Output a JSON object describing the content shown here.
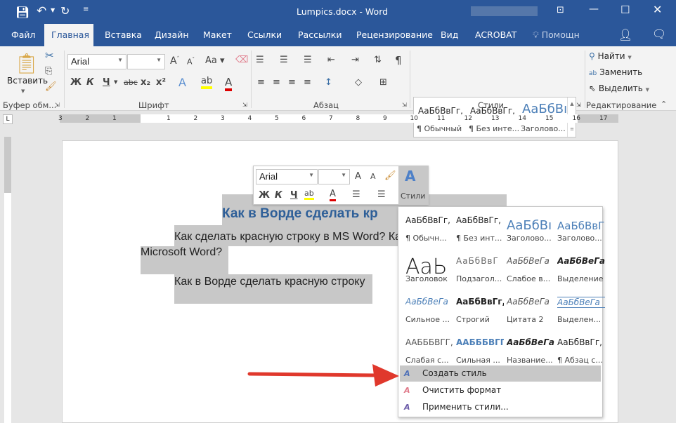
{
  "app": {
    "title": "Lumpics.docx - Word"
  },
  "quick_access": {
    "save": "save-icon",
    "undo": "undo-icon",
    "redo": "redo-icon",
    "customize": "customize-icon"
  },
  "tabs": [
    {
      "label": "Файл"
    },
    {
      "label": "Главная",
      "active": true
    },
    {
      "label": "Вставка"
    },
    {
      "label": "Дизайн"
    },
    {
      "label": "Макет"
    },
    {
      "label": "Ссылки"
    },
    {
      "label": "Рассылки"
    },
    {
      "label": "Рецензирование"
    },
    {
      "label": "Вид"
    },
    {
      "label": "ACROBAT"
    },
    {
      "label": "Помощн"
    }
  ],
  "ribbon": {
    "clipboard": {
      "paste": "Вставить",
      "group": "Буфер обм..."
    },
    "font": {
      "name": "Arial",
      "size": "",
      "bold": "Ж",
      "italic": "К",
      "underline": "Ч",
      "strike": "abc",
      "sub": "x₂",
      "sup": "x²",
      "case": "Aa",
      "group": "Шрифт"
    },
    "paragraph": {
      "group": "Абзац",
      "pilcrow": "¶"
    },
    "styles": {
      "group": "Стили",
      "items": [
        {
          "preview": "АаБбВвГг,",
          "name": "¶ Обычный"
        },
        {
          "preview": "АаБбВвГг,",
          "name": "¶ Без инте..."
        },
        {
          "preview": "АаБбВı",
          "name": "Заголово..."
        }
      ]
    },
    "editing": {
      "find": "Найти",
      "replace": "Заменить",
      "select": "Выделить",
      "group": "Редактирование"
    }
  },
  "ruler": {
    "ticks": [
      "3",
      "2",
      "1",
      "",
      "1",
      "2",
      "3",
      "4",
      "5",
      "6",
      "7",
      "8",
      "9",
      "10",
      "11",
      "12",
      "13",
      "14",
      "15",
      "16",
      "17"
    ]
  },
  "document": {
    "heading": "Как в Ворде сделать кр",
    "para1": "Как сделать красную строку в MS Word? Ка",
    "para1b": "Microsoft Word?",
    "para2": "Как в Ворде сделать красную строку"
  },
  "mini_toolbar": {
    "font": "Arial",
    "size": "",
    "bold": "Ж",
    "italic": "К",
    "underline": "Ч",
    "styles": "Стили"
  },
  "styles_menu": {
    "grid": [
      {
        "preview": "АаБбВвГг,",
        "name": "¶ Обычн..."
      },
      {
        "preview": "АаБбВвГг,",
        "name": "¶ Без инт..."
      },
      {
        "preview": "АаБбВı",
        "name": "Заголово..."
      },
      {
        "preview": "АаБбВвГ",
        "name": "Заголово..."
      },
      {
        "preview": "АаЬ",
        "name": "Заголовок"
      },
      {
        "preview": "АаБбВвГ",
        "name": "Подзагол..."
      },
      {
        "preview": "АаБбВеГа",
        "name": "Слабое в..."
      },
      {
        "preview": "АаБбВеГа",
        "name": "Выделение"
      },
      {
        "preview": "АаБбВеГа",
        "name": "Сильное ..."
      },
      {
        "preview": "АаБбВвГг,",
        "name": "Строгий"
      },
      {
        "preview": "АаБбВеГа",
        "name": "Цитата 2"
      },
      {
        "preview": "АаБбВеГа",
        "name": "Выделен..."
      },
      {
        "preview": "ААБББВГГ,",
        "name": "Слабая с..."
      },
      {
        "preview": "ААБББВГГ,",
        "name": "Сильная ..."
      },
      {
        "preview": "АаБбВеГа",
        "name": "Название..."
      },
      {
        "preview": "АаБбВвГг,",
        "name": "¶ Абзац с..."
      }
    ],
    "actions": [
      {
        "label": "Создать стиль",
        "icon": "create-style-icon",
        "highlighted": true
      },
      {
        "label": "Очистить формат",
        "icon": "clear-format-icon"
      },
      {
        "label": "Применить стили...",
        "icon": "apply-styles-icon"
      }
    ]
  },
  "colors": {
    "accent": "#2b579a",
    "selection": "#c8c8c8",
    "arrow": "#e0382c",
    "heading": "#2e5f98"
  }
}
